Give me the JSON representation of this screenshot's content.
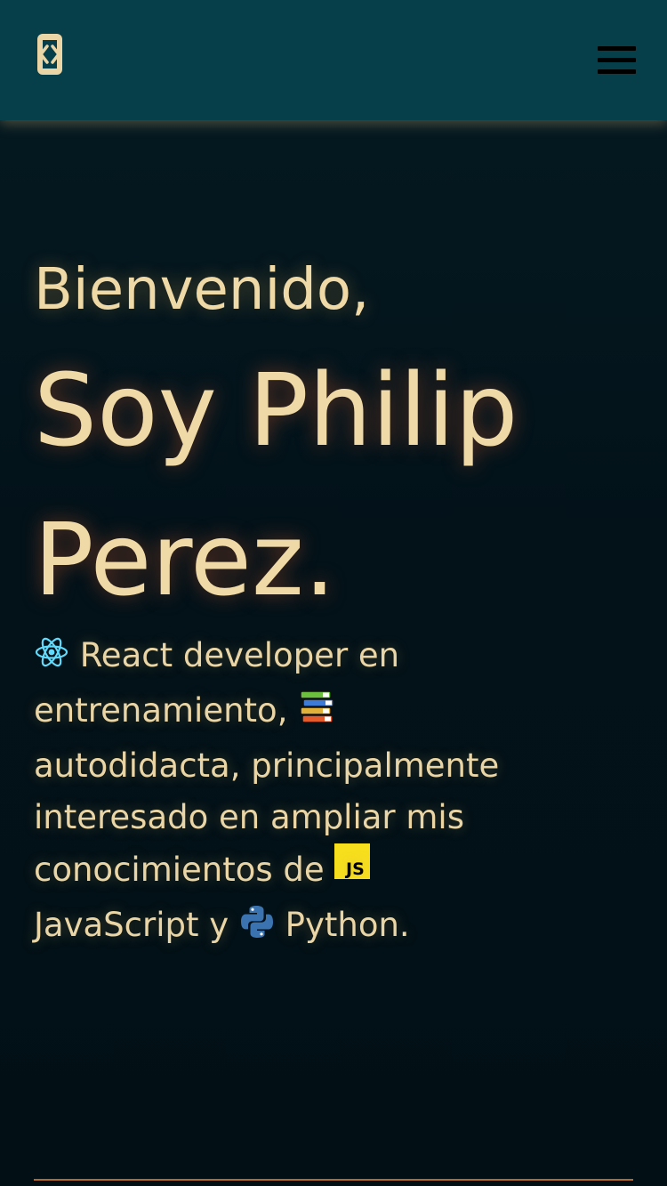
{
  "header": {
    "logo_icon": "code-bracket-icon",
    "menu_icon": "hamburger-menu-icon",
    "background_color": "#063f4a",
    "text_color": "#efd9a7"
  },
  "hero": {
    "greeting": "Bienvenido,",
    "name_line1": "Soy Philip",
    "name_line2": "Perez.",
    "bio": {
      "row1_text": "React developer en",
      "row2_text": "entrenamiento,",
      "row3_text": "autodidacta, principalmente",
      "row4_text": "interesado en ampliar mis",
      "row5_text": "conocimientos de",
      "row6_text_a": "JavaScript y",
      "row6_text_b": "Python.",
      "icons": [
        "react-icon",
        "books-icon",
        "javascript-icon",
        "python-icon"
      ]
    }
  },
  "colors": {
    "page_background": "#031219",
    "accent_line": "#b26a2c"
  }
}
